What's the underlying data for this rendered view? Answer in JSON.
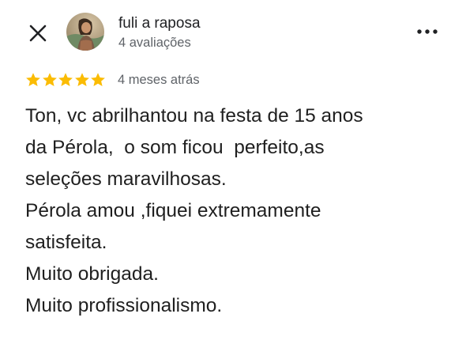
{
  "header": {
    "close_icon": "close-icon",
    "more_icon": "more-vert-icon",
    "author": {
      "name": "fuli a raposa",
      "meta": "4 avaliações",
      "avatar": "avatar-photo"
    }
  },
  "review": {
    "rating": 5,
    "rating_max": 5,
    "star_color": "#fbbc04",
    "date": "4 meses atrás",
    "lines": [
      "Ton, vc abrilhantou na festa de 15 anos",
      "da Pérola,  o som ficou  perfeito,as",
      "seleções maravilhosas.",
      "Pérola amou ,fiquei extremamente",
      "satisfeita.",
      "Muito obrigada.",
      "Muito profissionalismo."
    ]
  }
}
